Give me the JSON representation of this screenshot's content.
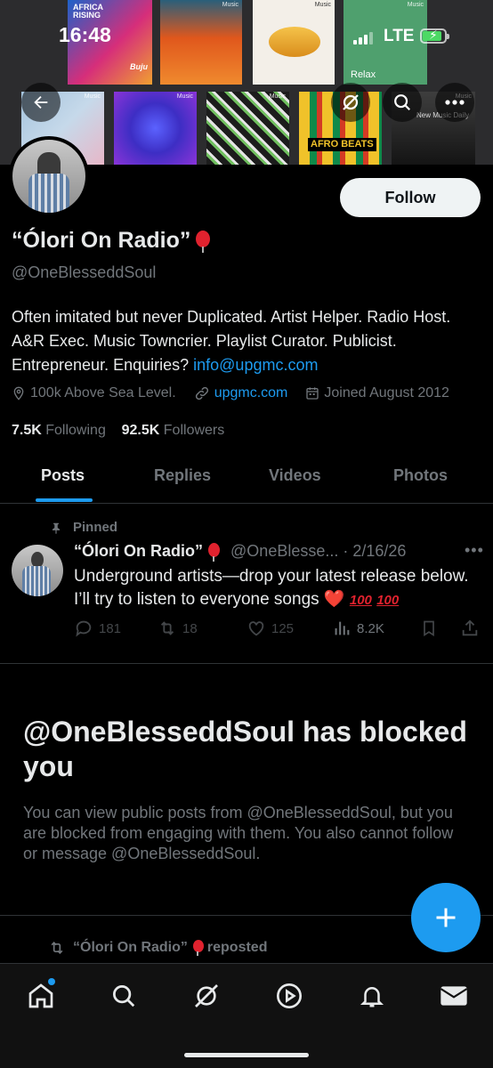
{
  "status_bar": {
    "time": "16:48",
    "network": "LTE"
  },
  "banner": {
    "tiles": {
      "t1_label": "AFRICA RISING",
      "t1_sub": "Buju",
      "music_tag": "Music",
      "t4_label": "Relax",
      "t8_label": "AFRO BEATS",
      "t9_label": "New Music Daily"
    }
  },
  "profile": {
    "follow_label": "Follow",
    "display_name": "“Ólori On Radio”",
    "handle": "@OneBlesseddSoul",
    "bio_text": "Often imitated but never Duplicated. Artist Helper. Radio Host. A&R Exec. Music Towncrier. Playlist Curator. Publicist. Entrepreneur. Enquiries? ",
    "bio_email": "info@upgmc.com",
    "location": "100k Above Sea Level.",
    "website": "upgmc.com",
    "joined": "Joined August 2012",
    "following_count": "7.5K",
    "following_label": "Following",
    "followers_count": "92.5K",
    "followers_label": "Followers"
  },
  "tabs": {
    "posts": "Posts",
    "replies": "Replies",
    "videos": "Videos",
    "photos": "Photos"
  },
  "pinned_post": {
    "pinned_label": "Pinned",
    "author": "“Ólori On Radio”",
    "handle": "@OneBlesse...",
    "date": "· 2/16/26",
    "text": "Underground artists—drop your latest release below. I’ll try to listen to everyone songs ",
    "heart": "❤️",
    "hundred_1": "100",
    "hundred_2": "100",
    "replies": "181",
    "reposts": "18",
    "likes": "125",
    "views": "8.2K"
  },
  "blocked": {
    "title": "@OneBlesseddSoul has blocked you",
    "description": "You can view public posts from @OneBlesseddSoul, but you are blocked from engaging with them. You also cannot follow or message @OneBlesseddSoul."
  },
  "repost_line": {
    "name": "“Ólori On Radio”",
    "suffix": "reposted"
  },
  "colors": {
    "accent": "#1d9bf0",
    "background": "#000000",
    "text": "#e7e9ea",
    "muted": "#71767b"
  },
  "icons": [
    "back-arrow-icon",
    "grok-icon",
    "search-icon",
    "more-icon",
    "location-icon",
    "link-icon",
    "calendar-icon",
    "pin-icon",
    "reply-icon",
    "repost-icon",
    "like-icon",
    "views-icon",
    "bookmark-icon",
    "share-icon",
    "compose-plus-icon",
    "home-icon",
    "explore-icon",
    "grok-nav-icon",
    "video-icon",
    "bell-icon",
    "mail-icon"
  ]
}
